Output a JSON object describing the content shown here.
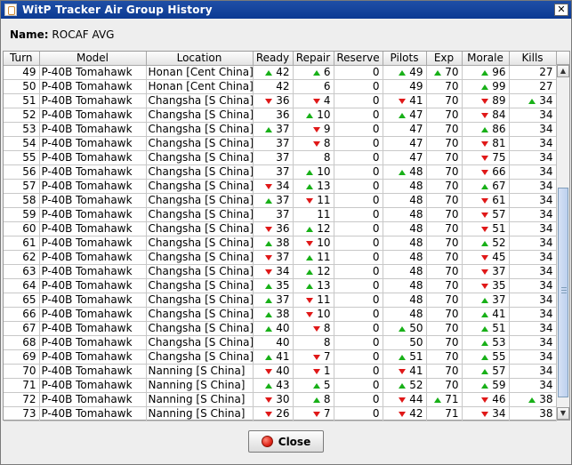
{
  "window": {
    "title": "WitP Tracker Air Group History",
    "close_glyph": "✕"
  },
  "name_row": {
    "label": "Name:",
    "value": "ROCAF AVG"
  },
  "columns": [
    "Turn",
    "Model",
    "Location",
    "Ready",
    "Repair",
    "Reserve",
    "Pilots",
    "Exp",
    "Morale",
    "Kills"
  ],
  "rows": [
    {
      "turn": "49",
      "model": "P-40B Tomahawk",
      "location": "Honan [Cent China]",
      "ready": "42",
      "ready_t": "up",
      "repair": "6",
      "repair_t": "up",
      "reserve": "0",
      "pilots": "49",
      "pilots_t": "up",
      "exp": "70",
      "exp_t": "up",
      "morale": "96",
      "morale_t": "up",
      "kills": "27",
      "kills_t": ""
    },
    {
      "turn": "50",
      "model": "P-40B Tomahawk",
      "location": "Honan [Cent China]",
      "ready": "42",
      "ready_t": "",
      "repair": "6",
      "repair_t": "",
      "reserve": "0",
      "pilots": "49",
      "pilots_t": "",
      "exp": "70",
      "exp_t": "",
      "morale": "99",
      "morale_t": "up",
      "kills": "27",
      "kills_t": ""
    },
    {
      "turn": "51",
      "model": "P-40B Tomahawk",
      "location": "Changsha [S China]",
      "ready": "36",
      "ready_t": "dn",
      "repair": "4",
      "repair_t": "dn",
      "reserve": "0",
      "pilots": "41",
      "pilots_t": "dn",
      "exp": "70",
      "exp_t": "",
      "morale": "89",
      "morale_t": "dn",
      "kills": "34",
      "kills_t": "up"
    },
    {
      "turn": "52",
      "model": "P-40B Tomahawk",
      "location": "Changsha [S China]",
      "ready": "36",
      "ready_t": "",
      "repair": "10",
      "repair_t": "up",
      "reserve": "0",
      "pilots": "47",
      "pilots_t": "up",
      "exp": "70",
      "exp_t": "",
      "morale": "84",
      "morale_t": "dn",
      "kills": "34",
      "kills_t": ""
    },
    {
      "turn": "53",
      "model": "P-40B Tomahawk",
      "location": "Changsha [S China]",
      "ready": "37",
      "ready_t": "up",
      "repair": "9",
      "repair_t": "dn",
      "reserve": "0",
      "pilots": "47",
      "pilots_t": "",
      "exp": "70",
      "exp_t": "",
      "morale": "86",
      "morale_t": "up",
      "kills": "34",
      "kills_t": ""
    },
    {
      "turn": "54",
      "model": "P-40B Tomahawk",
      "location": "Changsha [S China]",
      "ready": "37",
      "ready_t": "",
      "repair": "8",
      "repair_t": "dn",
      "reserve": "0",
      "pilots": "47",
      "pilots_t": "",
      "exp": "70",
      "exp_t": "",
      "morale": "81",
      "morale_t": "dn",
      "kills": "34",
      "kills_t": ""
    },
    {
      "turn": "55",
      "model": "P-40B Tomahawk",
      "location": "Changsha [S China]",
      "ready": "37",
      "ready_t": "",
      "repair": "8",
      "repair_t": "",
      "reserve": "0",
      "pilots": "47",
      "pilots_t": "",
      "exp": "70",
      "exp_t": "",
      "morale": "75",
      "morale_t": "dn",
      "kills": "34",
      "kills_t": ""
    },
    {
      "turn": "56",
      "model": "P-40B Tomahawk",
      "location": "Changsha [S China]",
      "ready": "37",
      "ready_t": "",
      "repair": "10",
      "repair_t": "up",
      "reserve": "0",
      "pilots": "48",
      "pilots_t": "up",
      "exp": "70",
      "exp_t": "",
      "morale": "66",
      "morale_t": "dn",
      "kills": "34",
      "kills_t": ""
    },
    {
      "turn": "57",
      "model": "P-40B Tomahawk",
      "location": "Changsha [S China]",
      "ready": "34",
      "ready_t": "dn",
      "repair": "13",
      "repair_t": "up",
      "reserve": "0",
      "pilots": "48",
      "pilots_t": "",
      "exp": "70",
      "exp_t": "",
      "morale": "67",
      "morale_t": "up",
      "kills": "34",
      "kills_t": ""
    },
    {
      "turn": "58",
      "model": "P-40B Tomahawk",
      "location": "Changsha [S China]",
      "ready": "37",
      "ready_t": "up",
      "repair": "11",
      "repair_t": "dn",
      "reserve": "0",
      "pilots": "48",
      "pilots_t": "",
      "exp": "70",
      "exp_t": "",
      "morale": "61",
      "morale_t": "dn",
      "kills": "34",
      "kills_t": ""
    },
    {
      "turn": "59",
      "model": "P-40B Tomahawk",
      "location": "Changsha [S China]",
      "ready": "37",
      "ready_t": "",
      "repair": "11",
      "repair_t": "",
      "reserve": "0",
      "pilots": "48",
      "pilots_t": "",
      "exp": "70",
      "exp_t": "",
      "morale": "57",
      "morale_t": "dn",
      "kills": "34",
      "kills_t": ""
    },
    {
      "turn": "60",
      "model": "P-40B Tomahawk",
      "location": "Changsha [S China]",
      "ready": "36",
      "ready_t": "dn",
      "repair": "12",
      "repair_t": "up",
      "reserve": "0",
      "pilots": "48",
      "pilots_t": "",
      "exp": "70",
      "exp_t": "",
      "morale": "51",
      "morale_t": "dn",
      "kills": "34",
      "kills_t": ""
    },
    {
      "turn": "61",
      "model": "P-40B Tomahawk",
      "location": "Changsha [S China]",
      "ready": "38",
      "ready_t": "up",
      "repair": "10",
      "repair_t": "dn",
      "reserve": "0",
      "pilots": "48",
      "pilots_t": "",
      "exp": "70",
      "exp_t": "",
      "morale": "52",
      "morale_t": "up",
      "kills": "34",
      "kills_t": ""
    },
    {
      "turn": "62",
      "model": "P-40B Tomahawk",
      "location": "Changsha [S China]",
      "ready": "37",
      "ready_t": "dn",
      "repair": "11",
      "repair_t": "up",
      "reserve": "0",
      "pilots": "48",
      "pilots_t": "",
      "exp": "70",
      "exp_t": "",
      "morale": "45",
      "morale_t": "dn",
      "kills": "34",
      "kills_t": ""
    },
    {
      "turn": "63",
      "model": "P-40B Tomahawk",
      "location": "Changsha [S China]",
      "ready": "34",
      "ready_t": "dn",
      "repair": "12",
      "repair_t": "up",
      "reserve": "0",
      "pilots": "48",
      "pilots_t": "",
      "exp": "70",
      "exp_t": "",
      "morale": "37",
      "morale_t": "dn",
      "kills": "34",
      "kills_t": ""
    },
    {
      "turn": "64",
      "model": "P-40B Tomahawk",
      "location": "Changsha [S China]",
      "ready": "35",
      "ready_t": "up",
      "repair": "13",
      "repair_t": "up",
      "reserve": "0",
      "pilots": "48",
      "pilots_t": "",
      "exp": "70",
      "exp_t": "",
      "morale": "35",
      "morale_t": "dn",
      "kills": "34",
      "kills_t": ""
    },
    {
      "turn": "65",
      "model": "P-40B Tomahawk",
      "location": "Changsha [S China]",
      "ready": "37",
      "ready_t": "up",
      "repair": "11",
      "repair_t": "dn",
      "reserve": "0",
      "pilots": "48",
      "pilots_t": "",
      "exp": "70",
      "exp_t": "",
      "morale": "37",
      "morale_t": "up",
      "kills": "34",
      "kills_t": ""
    },
    {
      "turn": "66",
      "model": "P-40B Tomahawk",
      "location": "Changsha [S China]",
      "ready": "38",
      "ready_t": "up",
      "repair": "10",
      "repair_t": "dn",
      "reserve": "0",
      "pilots": "48",
      "pilots_t": "",
      "exp": "70",
      "exp_t": "",
      "morale": "41",
      "morale_t": "up",
      "kills": "34",
      "kills_t": ""
    },
    {
      "turn": "67",
      "model": "P-40B Tomahawk",
      "location": "Changsha [S China]",
      "ready": "40",
      "ready_t": "up",
      "repair": "8",
      "repair_t": "dn",
      "reserve": "0",
      "pilots": "50",
      "pilots_t": "up",
      "exp": "70",
      "exp_t": "",
      "morale": "51",
      "morale_t": "up",
      "kills": "34",
      "kills_t": ""
    },
    {
      "turn": "68",
      "model": "P-40B Tomahawk",
      "location": "Changsha [S China]",
      "ready": "40",
      "ready_t": "",
      "repair": "8",
      "repair_t": "",
      "reserve": "0",
      "pilots": "50",
      "pilots_t": "",
      "exp": "70",
      "exp_t": "",
      "morale": "53",
      "morale_t": "up",
      "kills": "34",
      "kills_t": ""
    },
    {
      "turn": "69",
      "model": "P-40B Tomahawk",
      "location": "Changsha [S China]",
      "ready": "41",
      "ready_t": "up",
      "repair": "7",
      "repair_t": "dn",
      "reserve": "0",
      "pilots": "51",
      "pilots_t": "up",
      "exp": "70",
      "exp_t": "",
      "morale": "55",
      "morale_t": "up",
      "kills": "34",
      "kills_t": ""
    },
    {
      "turn": "70",
      "model": "P-40B Tomahawk",
      "location": "Nanning [S China]",
      "ready": "40",
      "ready_t": "dn",
      "repair": "1",
      "repair_t": "dn",
      "reserve": "0",
      "pilots": "41",
      "pilots_t": "dn",
      "exp": "70",
      "exp_t": "",
      "morale": "57",
      "morale_t": "up",
      "kills": "34",
      "kills_t": ""
    },
    {
      "turn": "71",
      "model": "P-40B Tomahawk",
      "location": "Nanning [S China]",
      "ready": "43",
      "ready_t": "up",
      "repair": "5",
      "repair_t": "up",
      "reserve": "0",
      "pilots": "52",
      "pilots_t": "up",
      "exp": "70",
      "exp_t": "",
      "morale": "59",
      "morale_t": "up",
      "kills": "34",
      "kills_t": ""
    },
    {
      "turn": "72",
      "model": "P-40B Tomahawk",
      "location": "Nanning [S China]",
      "ready": "30",
      "ready_t": "dn",
      "repair": "8",
      "repair_t": "up",
      "reserve": "0",
      "pilots": "44",
      "pilots_t": "dn",
      "exp": "71",
      "exp_t": "up",
      "morale": "46",
      "morale_t": "dn",
      "kills": "38",
      "kills_t": "up"
    },
    {
      "turn": "73",
      "model": "P-40B Tomahawk",
      "location": "Nanning [S China]",
      "ready": "26",
      "ready_t": "dn",
      "repair": "7",
      "repair_t": "dn",
      "reserve": "0",
      "pilots": "42",
      "pilots_t": "dn",
      "exp": "71",
      "exp_t": "",
      "morale": "34",
      "morale_t": "dn",
      "kills": "38",
      "kills_t": ""
    }
  ],
  "footer": {
    "close_label": "Close"
  },
  "colors": {
    "trend_up": "#18b018",
    "trend_down": "#e01818",
    "title_bar": "#0c3a93"
  }
}
